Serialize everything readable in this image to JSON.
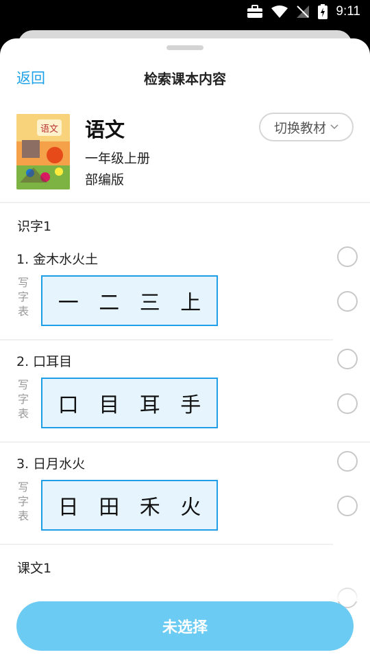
{
  "status_bar": {
    "time": "9:11"
  },
  "header": {
    "back_label": "返回",
    "title": "检索课本内容"
  },
  "book": {
    "subject": "语文",
    "grade": "一年级上册",
    "edition": "部编版",
    "cover_title": "语文",
    "switch_label": "切换教材"
  },
  "units": [
    {
      "label": "识字1",
      "lessons": [
        {
          "title": "1. 金木水火土",
          "table_label": [
            "写",
            "字",
            "表"
          ],
          "chars": [
            "一",
            "二",
            "三",
            "上"
          ]
        },
        {
          "title": "2. 口耳目",
          "table_label": [
            "写",
            "字",
            "表"
          ],
          "chars": [
            "口",
            "目",
            "耳",
            "手"
          ]
        },
        {
          "title": "3. 日月水火",
          "table_label": [
            "写",
            "字",
            "表"
          ],
          "chars": [
            "日",
            "田",
            "禾",
            "火"
          ]
        }
      ]
    },
    {
      "label": "课文1",
      "lessons": []
    }
  ],
  "footer": {
    "button_label": "未选择"
  },
  "colors": {
    "accent": "#1da1e8",
    "button": "#6ccbf2",
    "charbox_bg": "#e6f5fd",
    "charbox_border": "#1e9ee6"
  }
}
